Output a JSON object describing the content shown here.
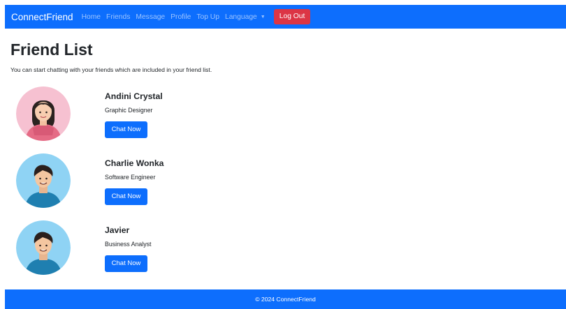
{
  "navbar": {
    "brand": "ConnectFriend",
    "links": [
      "Home",
      "Friends",
      "Message",
      "Profile",
      "Top Up"
    ],
    "language_label": "Language",
    "logout_label": "Log Out"
  },
  "page": {
    "title": "Friend List",
    "subtitle": "You can start chatting with your friends which are included in your friend list."
  },
  "friends": [
    {
      "name": "Andini Crystal",
      "role": "Graphic Designer",
      "button_label": "Chat Now",
      "avatar_icon": "female-avatar-icon"
    },
    {
      "name": "Charlie Wonka",
      "role": "Software Engineer",
      "button_label": "Chat Now",
      "avatar_icon": "male-avatar-icon"
    },
    {
      "name": "Javier",
      "role": "Business Analyst",
      "button_label": "Chat Now",
      "avatar_icon": "male-avatar-icon"
    }
  ],
  "footer": {
    "text": "© 2024 ConnectFriend"
  },
  "colors": {
    "primary": "#0d6efd",
    "danger": "#dc3545",
    "female_avatar_bg": "#f6c1d1",
    "male_avatar_bg": "#8fd3f4"
  }
}
